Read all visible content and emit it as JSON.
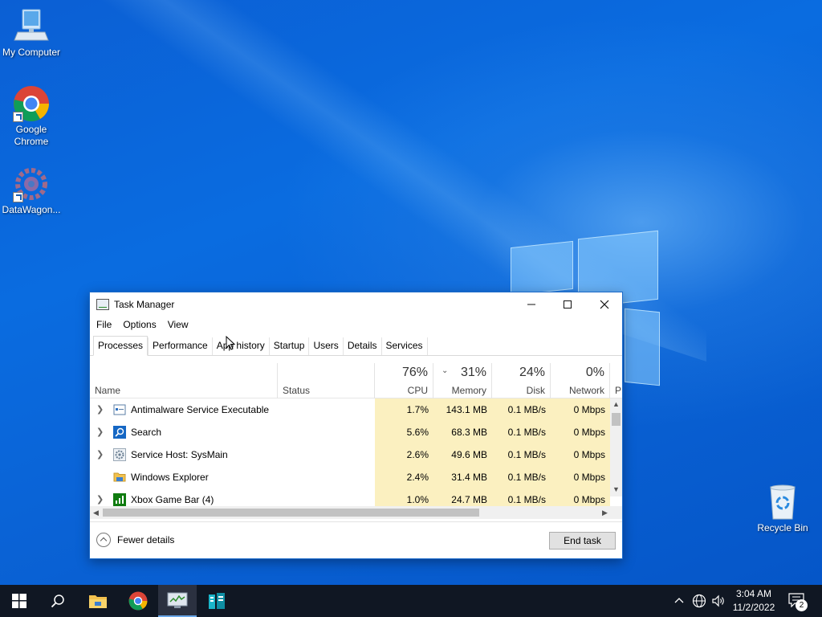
{
  "desktop": {
    "icons": [
      {
        "label": "My Computer"
      },
      {
        "label": "Google Chrome"
      },
      {
        "label": "DataWagon..."
      },
      {
        "label": "Recycle Bin"
      }
    ]
  },
  "task_manager": {
    "title": "Task Manager",
    "menu": [
      "File",
      "Options",
      "View"
    ],
    "tabs": [
      "Processes",
      "Performance",
      "App history",
      "Startup",
      "Users",
      "Details",
      "Services"
    ],
    "active_tab": "Processes",
    "columns": {
      "name": "Name",
      "status": "Status",
      "cpu": {
        "pct": "76%",
        "label": "CPU"
      },
      "memory": {
        "pct": "31%",
        "label": "Memory"
      },
      "disk": {
        "pct": "24%",
        "label": "Disk"
      },
      "network": {
        "pct": "0%",
        "label": "Network"
      },
      "power": {
        "label": "P"
      }
    },
    "rows": [
      {
        "name": "Antimalware Service Executable",
        "status": "",
        "cpu": "1.7%",
        "memory": "143.1 MB",
        "disk": "0.1 MB/s",
        "network": "0 Mbps",
        "expandable": true,
        "icon": "defender-icon"
      },
      {
        "name": "Search",
        "status": "",
        "cpu": "5.6%",
        "memory": "68.3 MB",
        "disk": "0.1 MB/s",
        "network": "0 Mbps",
        "expandable": true,
        "icon": "search-app-icon"
      },
      {
        "name": "Service Host: SysMain",
        "status": "",
        "cpu": "2.6%",
        "memory": "49.6 MB",
        "disk": "0.1 MB/s",
        "network": "0 Mbps",
        "expandable": true,
        "icon": "gear-service-icon"
      },
      {
        "name": "Windows Explorer",
        "status": "",
        "cpu": "2.4%",
        "memory": "31.4 MB",
        "disk": "0.1 MB/s",
        "network": "0 Mbps",
        "expandable": false,
        "icon": "folder-icon"
      },
      {
        "name": "Xbox Game Bar (4)",
        "status": "",
        "cpu": "1.0%",
        "memory": "24.7 MB",
        "disk": "0.1 MB/s",
        "network": "0 Mbps",
        "expandable": true,
        "icon": "xbox-gamebar-icon"
      }
    ],
    "footer": {
      "fewer_details": "Fewer details",
      "end_task": "End task"
    },
    "accent_heat_color": "#fbf0c0"
  },
  "taskbar": {
    "items": [
      "start-icon",
      "search-icon",
      "file-explorer-icon",
      "chrome-icon",
      "task-manager-icon",
      "datawagon-icon"
    ],
    "tray": {
      "time": "3:04 AM",
      "date": "11/2/2022",
      "notification_count": "2"
    }
  }
}
